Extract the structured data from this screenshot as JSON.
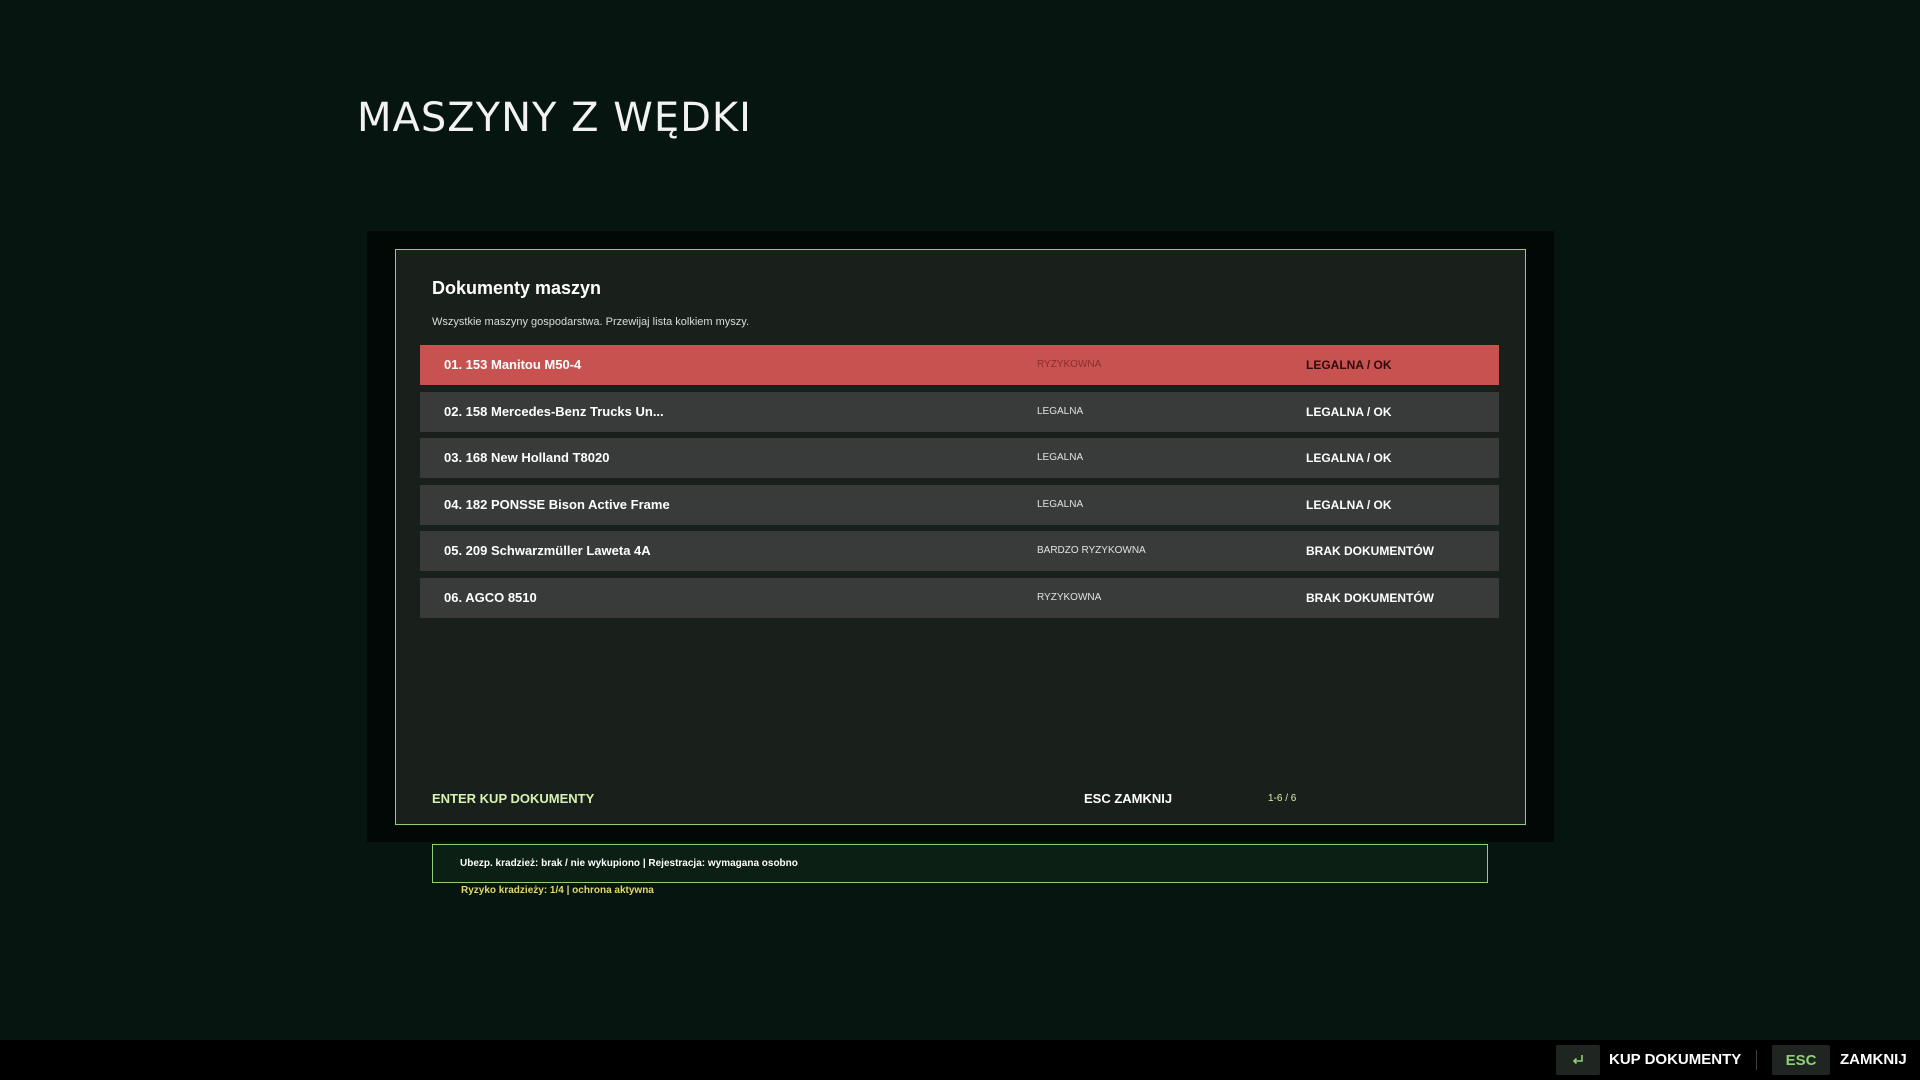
{
  "page_title": "MASZYNY Z WĘDKI",
  "panel": {
    "title": "Dokumenty maszyn",
    "subtitle": "Wszystkie maszyny gospodarstwa. Przewijaj lista kolkiem myszy.",
    "rows": [
      {
        "name": "01. 153 Manitou M50-4",
        "risk": "RYZYKOWNA",
        "status": "LEGALNA / OK",
        "selected": true
      },
      {
        "name": "02. 158 Mercedes-Benz Trucks Un...",
        "risk": "LEGALNA",
        "status": "LEGALNA / OK",
        "selected": false
      },
      {
        "name": "03. 168 New Holland T8020",
        "risk": "LEGALNA",
        "status": "LEGALNA / OK",
        "selected": false
      },
      {
        "name": "04. 182 PONSSE Bison Active Frame",
        "risk": "LEGALNA",
        "status": "LEGALNA / OK",
        "selected": false
      },
      {
        "name": "05. 209 Schwarzmüller Laweta 4A",
        "risk": "BARDZO RYZYKOWNA",
        "status": "BRAK DOKUMENTÓW",
        "selected": false
      },
      {
        "name": "06. AGCO 8510",
        "risk": "RYZYKOWNA",
        "status": "BRAK DOKUMENTÓW",
        "selected": false
      }
    ],
    "footer": {
      "enter_hint": "ENTER KUP DOKUMENTY",
      "esc_hint": "ESC ZAMKNIJ",
      "pager": "1-6 / 6"
    }
  },
  "info": {
    "line": "Ubezp. kradzież: brak / nie wykupiono  |  Rejestracja: wymagana osobno",
    "risk_line": "Ryzyko kradzieży: 1/4  |  ochrona aktywna"
  },
  "bottom_bar": {
    "enter_icon": "enter-key-icon",
    "kup_label": "KUP DOKUMENTY",
    "esc_key": "ESC",
    "zamknij_label": "ZAMKNIJ"
  },
  "colors": {
    "background": "#061510",
    "panel": "#19201b",
    "accent_border": "#8fcf78",
    "row": "#383b39",
    "row_selected": "#c85250",
    "hint_green": "#d6f2b2",
    "risk_yellow": "#e2d86a"
  }
}
